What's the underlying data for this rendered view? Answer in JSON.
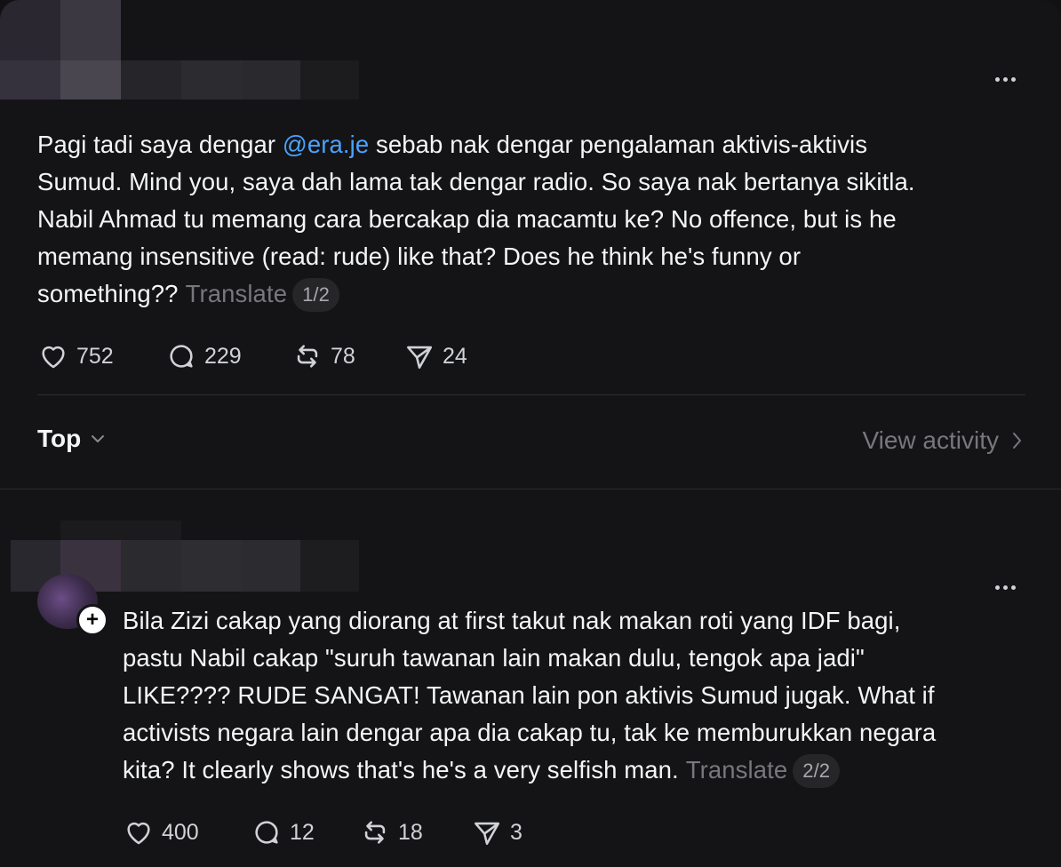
{
  "post1": {
    "text_before_mention": "Pagi tadi saya dengar ",
    "mention": "@era.je",
    "lines": [
      " sebab nak dengar pengalaman aktivis-aktivis",
      "Sumud. Mind you, saya dah lama tak dengar radio. So saya nak bertanya sikitla.",
      "Nabil Ahmad tu memang cara bercakap dia macamtu ke? No offence, but is he",
      "memang insensitive (read: rude) like that? Does he think he's funny or",
      "something??"
    ],
    "translate_label": "Translate",
    "thread_index": "1/2",
    "likes": "752",
    "replies": "229",
    "reposts": "78",
    "shares": "24"
  },
  "sort": {
    "label": "Top"
  },
  "view_activity": {
    "label": "View activity"
  },
  "post2": {
    "lines": [
      "Bila Zizi cakap yang diorang at first takut nak makan roti yang IDF bagi,",
      "pastu Nabil cakap \"suruh tawanan lain makan dulu, tengok apa jadi\"",
      "LIKE???? RUDE SANGAT! Tawanan lain pon aktivis Sumud jugak. What if",
      "activists negara lain dengar apa dia cakap tu, tak ke memburukkan negara",
      "kita? It clearly shows that's he's a very selfish man."
    ],
    "translate_label": "Translate",
    "thread_index": "2/2",
    "likes": "400",
    "replies": "12",
    "reposts": "18",
    "shares": "3"
  },
  "icons": {
    "like": "heart-icon",
    "reply": "speech-bubble-icon",
    "repost": "repost-icon",
    "share": "paper-plane-icon",
    "more": "ellipsis-icon",
    "follow": "plus-icon"
  },
  "colors": {
    "background": "#141416",
    "text": "#f3f5f7",
    "mention": "#4aa3ff",
    "muted": "#77777c"
  }
}
